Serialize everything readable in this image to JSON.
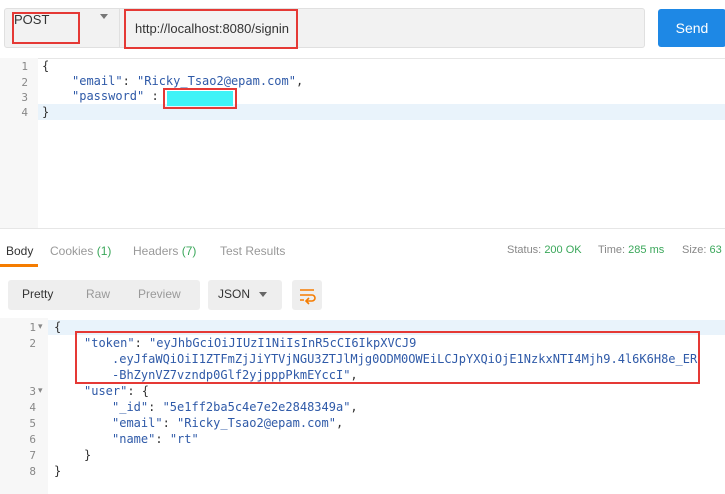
{
  "request": {
    "method": "POST",
    "url": "http://localhost:8080/signin",
    "send_label": "Send"
  },
  "body_editor": {
    "line_numbers": [
      "1",
      "2",
      "3",
      "4"
    ],
    "lines": {
      "open": "{",
      "email_key": "\"email\"",
      "email_sep": ": ",
      "email_value": "\"Ricky_Tsao2@epam.com\"",
      "email_end": ",",
      "password_key": "\"password\"",
      "password_sep": " : ",
      "close": "}"
    }
  },
  "response_tabs": {
    "body": "Body",
    "cookies": "Cookies",
    "cookies_count": "(1)",
    "headers": "Headers",
    "headers_count": "(7)",
    "test_results": "Test Results"
  },
  "response_meta": {
    "status_label": "Status:",
    "status_value": "200 OK",
    "time_label": "Time:",
    "time_value": "285 ms",
    "size_label": "Size:",
    "size_value": "63"
  },
  "view_modes": {
    "pretty": "Pretty",
    "raw": "Raw",
    "preview": "Preview",
    "format": "JSON"
  },
  "response_body": {
    "line_numbers": [
      "1",
      "2",
      "",
      "",
      "3",
      "4",
      "5",
      "6",
      "7",
      "8"
    ],
    "open": "{",
    "token_key": "\"token\"",
    "token_sep": ": ",
    "token_line1": "\"eyJhbGciOiJIUzI1NiIsInR5cCI6IkpXVCJ9",
    "token_line2": ".eyJfaWQiOiI1ZTFmZjJiYTVjNGU3ZTJlMjg0ODM0OWEiLCJpYXQiOjE1NzkxNTI4Mjh9.4l6K6H8e_ER",
    "token_line3": "-BhZynVZ7vzndp0Glf2yjpppPkmEYccI\"",
    "token_end": ",",
    "user_key": "\"user\"",
    "user_sep": ": {",
    "id_key": "\"_id\"",
    "id_value": "\"5e1ff2ba5c4e7e2e2848349a\"",
    "email_key": "\"email\"",
    "email_value": "\"Ricky_Tsao2@epam.com\"",
    "name_key": "\"name\"",
    "name_value": "\"rt\"",
    "comma": ",",
    "colon": ": ",
    "user_close": "}",
    "close": "}"
  },
  "colors": {
    "send_button": "#1e88e5",
    "highlight_box": "#e53935",
    "redacted_fill": "#40f3f7",
    "status_ok": "#3aa75a",
    "active_tab_underline": "#f57c00"
  },
  "icons": {
    "method_dropdown": "chevron-down-icon",
    "format_dropdown": "chevron-down-icon",
    "wrap_lines": "wrap-lines-icon",
    "fold": "fold-caret-icon"
  }
}
